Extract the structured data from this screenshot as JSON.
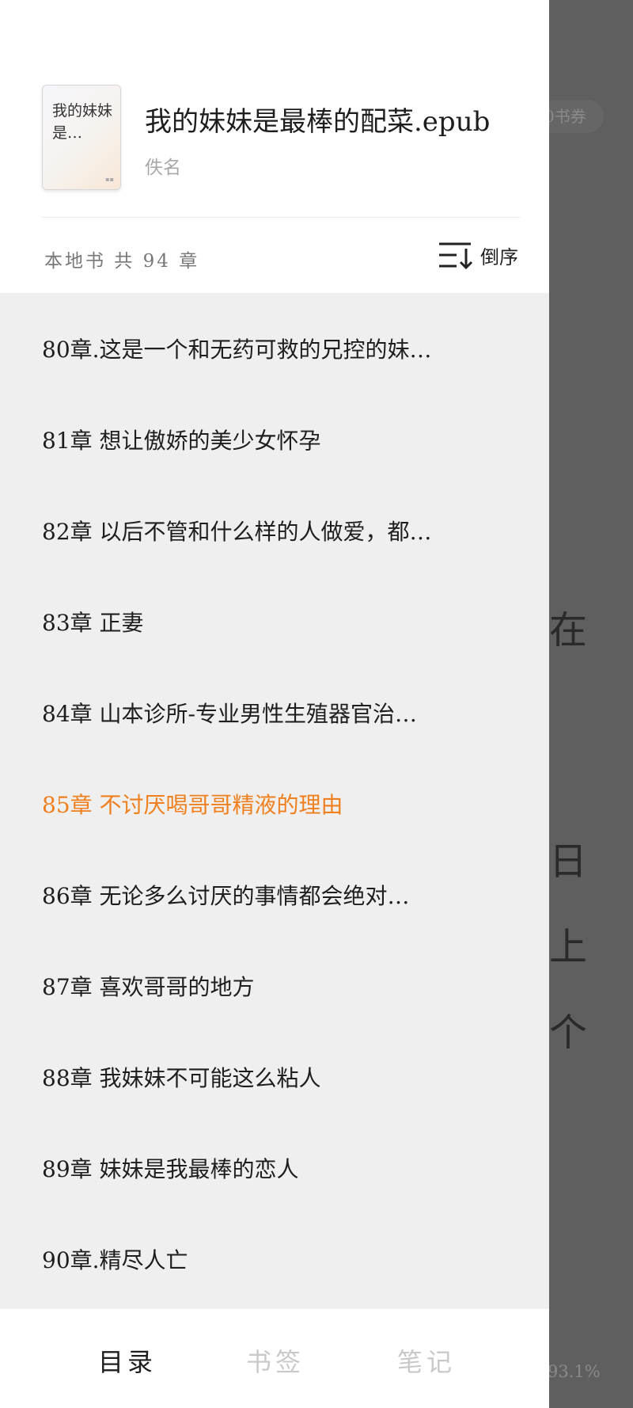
{
  "background": {
    "voucher": "0书券",
    "chars": [
      "在",
      "日",
      "上",
      "个"
    ],
    "progress": "93.1%"
  },
  "book": {
    "cover_title": "我的妹妹是…",
    "title": "我的妹妹是最棒的配菜.epub",
    "author": "佚名"
  },
  "toc": {
    "chapter_count": "本地书 共 94 章",
    "sort_label": "倒序",
    "current_color": "#f07f1d",
    "chapters": [
      {
        "title": "80章.这是一个和无药可救的兄控的妹…"
      },
      {
        "title": "81章 想让傲娇的美少女怀孕"
      },
      {
        "title": "82章 以后不管和什么样的人做爱，都…"
      },
      {
        "title": "83章 正妻"
      },
      {
        "title": "84章 山本诊所-专业男性生殖器官治…"
      },
      {
        "title": "85章 不讨厌喝哥哥精液的理由",
        "current": true
      },
      {
        "title": "86章 无论多么讨厌的事情都会绝对…"
      },
      {
        "title": "87章 喜欢哥哥的地方"
      },
      {
        "title": "88章 我妹妹不可能这么粘人"
      },
      {
        "title": "89章 妹妹是我最棒的恋人"
      },
      {
        "title": "90章.精尽人亡"
      }
    ]
  },
  "tabs": {
    "toc": "目录",
    "bookmarks": "书签",
    "notes": "笔记"
  }
}
